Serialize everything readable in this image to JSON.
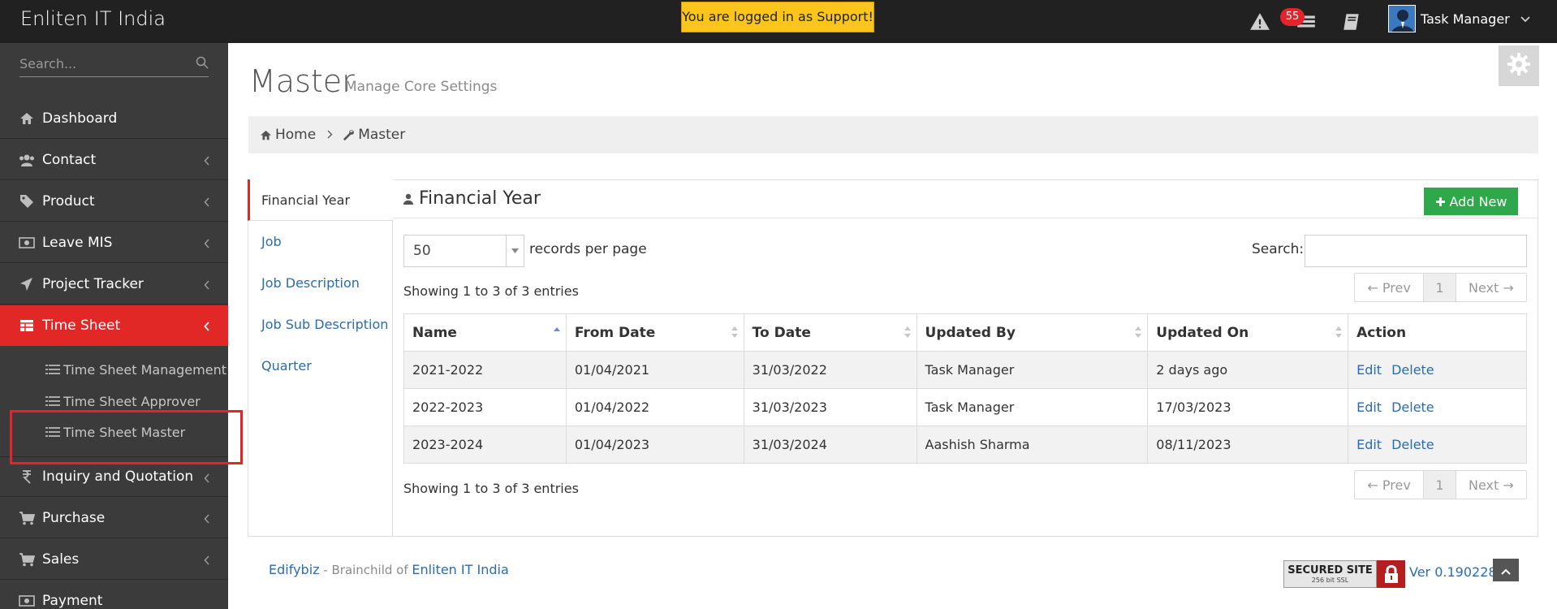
{
  "header": {
    "brand": "Enliten IT India",
    "support_notice": "You are logged in as Support!",
    "notification_count": "55",
    "user_name": "Task Manager"
  },
  "sidebar": {
    "search_placeholder": "Search...",
    "items": [
      {
        "label": "Dashboard",
        "icon": "home-icon"
      },
      {
        "label": "Contact",
        "icon": "users-icon"
      },
      {
        "label": "Product",
        "icon": "tag-icon"
      },
      {
        "label": "Leave MIS",
        "icon": "money-icon"
      },
      {
        "label": "Project Tracker",
        "icon": "plane-icon"
      },
      {
        "label": "Time Sheet",
        "icon": "table-icon"
      },
      {
        "label": "Inquiry and Quotation",
        "icon": "rupee-icon"
      },
      {
        "label": "Purchase",
        "icon": "cart-icon"
      },
      {
        "label": "Sales",
        "icon": "cart-icon"
      },
      {
        "label": "Payment",
        "icon": "money-icon"
      }
    ],
    "sub_items": [
      {
        "label": "Time Sheet Management"
      },
      {
        "label": "Time Sheet Approver"
      },
      {
        "label": "Time Sheet Master"
      }
    ]
  },
  "page": {
    "title": "Master",
    "subtitle": "Manage Core Settings"
  },
  "breadcrumb": {
    "home": "Home",
    "current": "Master"
  },
  "tabs": [
    "Financial Year",
    "Job",
    "Job Description",
    "Job Sub Description",
    "Quarter"
  ],
  "section": {
    "title": "Financial Year",
    "add_new": "Add New"
  },
  "datatable": {
    "page_length": "50",
    "length_label": "records per page",
    "search_label": "Search:",
    "info": "Showing 1 to 3 of 3 entries",
    "pager": {
      "prev": "← Prev",
      "page": "1",
      "next": "Next →"
    },
    "columns": [
      "Name",
      "From Date",
      "To Date",
      "Updated By",
      "Updated On",
      "Action"
    ],
    "rows": [
      {
        "name": "2021-2022",
        "from": "01/04/2021",
        "to": "31/03/2022",
        "updated_by": "Task Manager",
        "updated_on": "2 days ago"
      },
      {
        "name": "2022-2023",
        "from": "01/04/2022",
        "to": "31/03/2023",
        "updated_by": "Task Manager",
        "updated_on": "17/03/2023"
      },
      {
        "name": "2023-2024",
        "from": "01/04/2023",
        "to": "31/03/2024",
        "updated_by": "Aashish Sharma",
        "updated_on": "08/11/2023"
      }
    ],
    "action_edit": "Edit",
    "action_delete": "Delete"
  },
  "footer": {
    "product": "Edifybiz",
    "mid": " - Brainchild of ",
    "company": "Enliten IT India",
    "ssl_main": "SECURED SITE",
    "ssl_sub": "256 bit SSL",
    "version": "Ver 0.190228"
  },
  "colors": {
    "topbar": "#212121",
    "sidebar": "#3b3b3b",
    "active": "#e22727",
    "support_badge": "#fcc51c",
    "add_new": "#2ea84b",
    "link": "#2a6cb0"
  }
}
